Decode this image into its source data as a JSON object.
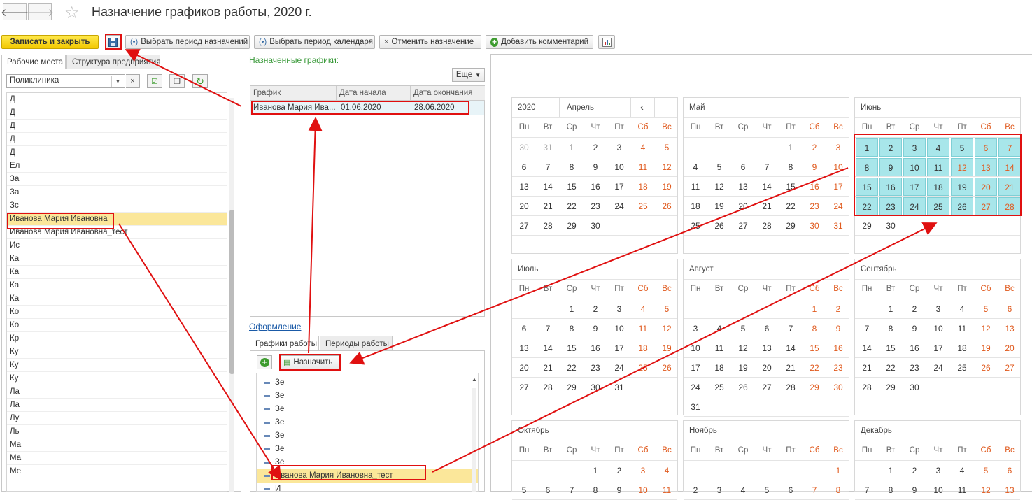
{
  "window": {
    "title": "Назначение графиков работы, 2020 г."
  },
  "toolbar": {
    "save_close": "Записать и закрыть",
    "select_assign_period": "Выбрать период назначений",
    "select_calendar_period": "Выбрать период календаря",
    "cancel_assign": "Отменить назначение",
    "add_comment": "Добавить комментарий"
  },
  "left": {
    "tabs": [
      "Рабочие места",
      "Структура предприятия"
    ],
    "search_value": "Поликлиника",
    "rows": [
      "Д",
      "Д",
      "Д",
      "Д",
      "Д",
      "Ел",
      "За",
      "За",
      "Зс",
      "Иванова Мария Ивановна",
      "Иванова Мария Ивановна_тест",
      "Ис",
      "Ка",
      "Ка",
      "Ка",
      "Ка",
      "Ко",
      "Ко",
      "Кр",
      "Ку",
      "Ку",
      "Ку",
      "Ла",
      "Ла",
      "Лу",
      "Ль",
      "Ма",
      "Ма",
      "Ме"
    ]
  },
  "middle": {
    "assigned_label": "Назначенные графики:",
    "more_label": "Еще",
    "columns": [
      "График",
      "Дата начала",
      "Дата окончания"
    ],
    "assigned_rows": [
      {
        "schedule": "Иванова Мария Ива...",
        "start": "01.06.2020",
        "end": "28.06.2020"
      }
    ],
    "design_link": "Оформление",
    "tabs": [
      "Графики работы",
      "Периоды работы"
    ],
    "assign_label": "Назначить",
    "list": [
      "Зе",
      "Зе",
      "Зе",
      "Зе",
      "Зе",
      "Зе",
      "Зе",
      "Иванова Мария Ивановна_тест",
      "И"
    ]
  },
  "calendar": {
    "year": "2020",
    "selector_month": "Апрель",
    "prev_icon": "‹",
    "weekdays": [
      "Пн",
      "Вт",
      "Ср",
      "Чт",
      "Пт",
      "Сб",
      "Вс"
    ],
    "months": [
      {
        "name": "Май",
        "weeks": [
          [
            "",
            "",
            "",
            "",
            "1",
            "2",
            "3"
          ],
          [
            "4",
            "5",
            "6",
            "7",
            "8",
            "9",
            "10"
          ],
          [
            "11",
            "12",
            "13",
            "14",
            "15",
            "16",
            "17"
          ],
          [
            "18",
            "19",
            "20",
            "21",
            "22",
            "23",
            "24"
          ],
          [
            "25",
            "26",
            "27",
            "28",
            "29",
            "30",
            "31"
          ]
        ]
      },
      {
        "name": "Июнь",
        "weeks": [
          [
            "1",
            "2",
            "3",
            "4",
            "5",
            "6",
            "7"
          ],
          [
            "8",
            "9",
            "10",
            "11",
            "12",
            "13",
            "14"
          ],
          [
            "15",
            "16",
            "17",
            "18",
            "19",
            "20",
            "21"
          ],
          [
            "22",
            "23",
            "24",
            "25",
            "26",
            "27",
            "28"
          ],
          [
            "29",
            "30",
            "",
            "",
            "",
            "",
            ""
          ]
        ]
      },
      {
        "name": "Июль",
        "weeks": [
          [
            "",
            "",
            "1",
            "2",
            "3",
            "4",
            "5"
          ],
          [
            "6",
            "7",
            "8",
            "9",
            "10",
            "11",
            "12"
          ],
          [
            "13",
            "14",
            "15",
            "16",
            "17",
            "18",
            "19"
          ],
          [
            "20",
            "21",
            "22",
            "23",
            "24",
            "25",
            "26"
          ],
          [
            "27",
            "28",
            "29",
            "30",
            "31",
            "",
            ""
          ]
        ]
      },
      {
        "name": "Август",
        "weeks": [
          [
            "",
            "",
            "",
            "",
            "",
            "1",
            "2"
          ],
          [
            "3",
            "4",
            "5",
            "6",
            "7",
            "8",
            "9"
          ],
          [
            "10",
            "11",
            "12",
            "13",
            "14",
            "15",
            "16"
          ],
          [
            "17",
            "18",
            "19",
            "20",
            "21",
            "22",
            "23"
          ],
          [
            "24",
            "25",
            "26",
            "27",
            "28",
            "29",
            "30"
          ],
          [
            "31",
            "",
            "",
            "",
            "",
            "",
            ""
          ]
        ]
      },
      {
        "name": "Сентябрь",
        "weeks": [
          [
            "",
            "1",
            "2",
            "3",
            "4",
            "5",
            "6"
          ],
          [
            "7",
            "8",
            "9",
            "10",
            "11",
            "12",
            "13"
          ],
          [
            "14",
            "15",
            "16",
            "17",
            "18",
            "19",
            "20"
          ],
          [
            "21",
            "22",
            "23",
            "24",
            "25",
            "26",
            "27"
          ],
          [
            "28",
            "29",
            "30",
            "",
            "",
            "",
            ""
          ]
        ]
      },
      {
        "name": "Октябрь",
        "weeks": [
          [
            "",
            "",
            "",
            "1",
            "2",
            "3",
            "4"
          ],
          [
            "5",
            "6",
            "7",
            "8",
            "9",
            "10",
            "11"
          ]
        ]
      },
      {
        "name": "Ноябрь",
        "weeks": [
          [
            "",
            "",
            "",
            "",
            "",
            "",
            "1"
          ],
          [
            "2",
            "3",
            "4",
            "5",
            "6",
            "7",
            "8"
          ]
        ]
      },
      {
        "name": "Декабрь",
        "weeks": [
          [
            "",
            "1",
            "2",
            "3",
            "4",
            "5",
            "6"
          ],
          [
            "7",
            "8",
            "9",
            "10",
            "11",
            "12",
            "13"
          ]
        ]
      }
    ],
    "april_weeks": [
      [
        "30",
        "31",
        "1",
        "2",
        "3",
        "4",
        "5"
      ],
      [
        "6",
        "7",
        "8",
        "9",
        "10",
        "11",
        "12"
      ],
      [
        "13",
        "14",
        "15",
        "16",
        "17",
        "18",
        "19"
      ],
      [
        "20",
        "21",
        "22",
        "23",
        "24",
        "25",
        "26"
      ],
      [
        "27",
        "28",
        "29",
        "30",
        "",
        "",
        ""
      ]
    ],
    "highlighted_month": "Июнь",
    "highlighted_days": [
      "1",
      "2",
      "3",
      "4",
      "5",
      "6",
      "7",
      "8",
      "9",
      "10",
      "11",
      "12",
      "13",
      "14",
      "15",
      "16",
      "17",
      "18",
      "19",
      "20",
      "21",
      "22",
      "23",
      "24",
      "25",
      "26",
      "27",
      "28"
    ],
    "red_days": {
      "Июнь": [
        "12"
      ]
    },
    "colors": {
      "highlight": "#a8e6ea",
      "weekend": "#e05a1e"
    }
  },
  "icons": {
    "back": "arrow-left-icon",
    "forward": "arrow-right-icon",
    "star": "star-icon",
    "save": "floppy-icon"
  }
}
